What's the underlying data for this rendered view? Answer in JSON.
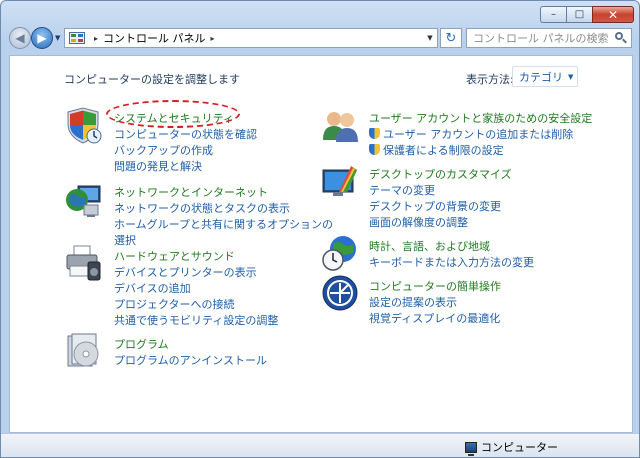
{
  "window": {
    "minimize": "–",
    "maximize": "□",
    "close": "✕"
  },
  "address": {
    "crumb": "コントロール パネル",
    "separator": "▸"
  },
  "search": {
    "placeholder": "コントロール パネルの検索"
  },
  "content": {
    "heading": "コンピューターの設定を調整します",
    "view_by_label": "表示方法:",
    "view_by_value": "カテゴリ"
  },
  "categories": {
    "system": {
      "title": "システムとセキュリティ",
      "links": [
        "コンピューターの状態を確認",
        "バックアップの作成",
        "問題の発見と解決"
      ]
    },
    "network": {
      "title": "ネットワークとインターネット",
      "links": [
        "ネットワークの状態とタスクの表示",
        "ホームグループと共有に関するオプションの",
        "選択"
      ]
    },
    "hardware": {
      "title": "ハードウェアとサウンド",
      "links": [
        "デバイスとプリンターの表示",
        "デバイスの追加",
        "プロジェクターへの接続",
        "共通で使うモビリティ設定の調整"
      ]
    },
    "programs": {
      "title": "プログラム",
      "links": [
        "プログラムのアンインストール"
      ]
    },
    "users": {
      "title": "ユーザー アカウントと家族のための安全設定",
      "links": [
        "ユーザー アカウントの追加または削除",
        "保護者による制限の設定"
      ]
    },
    "appearance": {
      "title": "デスクトップのカスタマイズ",
      "links": [
        "テーマの変更",
        "デスクトップの背景の変更",
        "画面の解像度の調整"
      ]
    },
    "clock": {
      "title": "時計、言語、および地域",
      "links": [
        "キーボードまたは入力方法の変更"
      ]
    },
    "ease": {
      "title": "コンピューターの簡単操作",
      "links": [
        "設定の提案の表示",
        "視覚ディスプレイの最適化"
      ]
    }
  },
  "status": {
    "text": "コンピューター"
  },
  "colors": {
    "category_title": "#1f7a1f",
    "link": "#1e5ea8",
    "annotation": "#d61f1f"
  }
}
